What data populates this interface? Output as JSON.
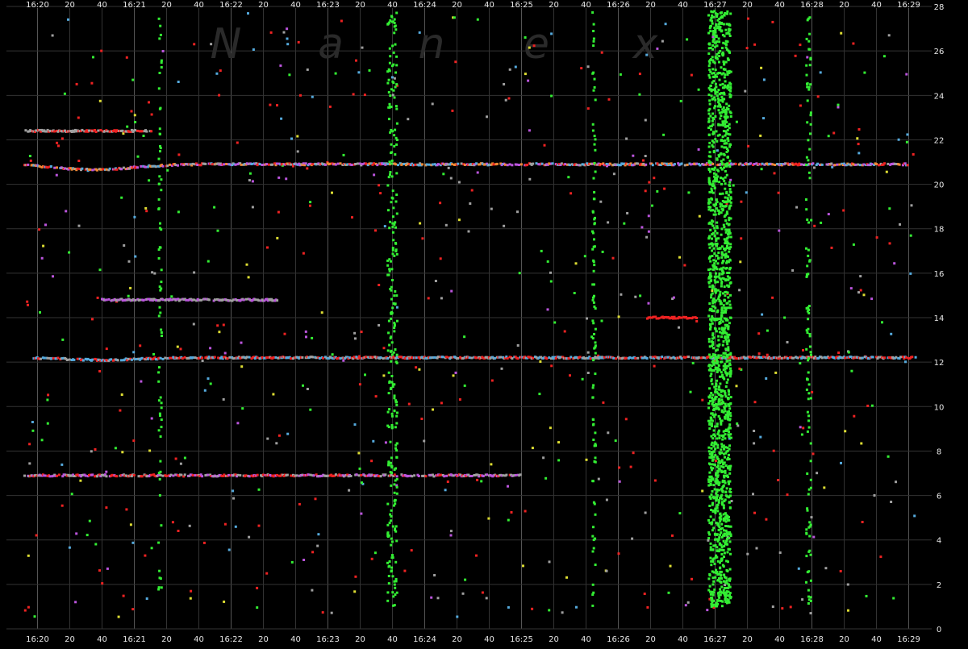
{
  "chart_data": {
    "type": "scatter",
    "watermark": [
      "N",
      "a",
      "n",
      "e",
      "x"
    ],
    "x_axis": {
      "range_seconds_after_1620": [
        -10,
        560
      ],
      "ticks": [
        {
          "t": 0,
          "label": "16:20",
          "major": true
        },
        {
          "t": 20,
          "label": "20",
          "major": false
        },
        {
          "t": 40,
          "label": "40",
          "major": false
        },
        {
          "t": 60,
          "label": "16:21",
          "major": true
        },
        {
          "t": 80,
          "label": "20",
          "major": false
        },
        {
          "t": 100,
          "label": "40",
          "major": false
        },
        {
          "t": 120,
          "label": "16:22",
          "major": true
        },
        {
          "t": 140,
          "label": "20",
          "major": false
        },
        {
          "t": 160,
          "label": "40",
          "major": false
        },
        {
          "t": 180,
          "label": "16:23",
          "major": true
        },
        {
          "t": 200,
          "label": "20",
          "major": false
        },
        {
          "t": 220,
          "label": "40",
          "major": false
        },
        {
          "t": 240,
          "label": "16:24",
          "major": true
        },
        {
          "t": 260,
          "label": "20",
          "major": false
        },
        {
          "t": 280,
          "label": "40",
          "major": false
        },
        {
          "t": 300,
          "label": "16:25",
          "major": true
        },
        {
          "t": 320,
          "label": "20",
          "major": false
        },
        {
          "t": 340,
          "label": "40",
          "major": false
        },
        {
          "t": 360,
          "label": "16:26",
          "major": true
        },
        {
          "t": 380,
          "label": "20",
          "major": false
        },
        {
          "t": 400,
          "label": "40",
          "major": false
        },
        {
          "t": 420,
          "label": "16:27",
          "major": true
        },
        {
          "t": 440,
          "label": "20",
          "major": false
        },
        {
          "t": 460,
          "label": "40",
          "major": false
        },
        {
          "t": 480,
          "label": "16:28",
          "major": true
        },
        {
          "t": 500,
          "label": "20",
          "major": false
        },
        {
          "t": 520,
          "label": "40",
          "major": false
        },
        {
          "t": 540,
          "label": "16:29",
          "major": true
        }
      ]
    },
    "y_axis": {
      "range": [
        0,
        28
      ],
      "ticks": [
        0,
        2,
        4,
        6,
        8,
        10,
        12,
        14,
        16,
        18,
        20,
        22,
        24,
        26,
        28
      ]
    },
    "grid": true,
    "colors": {
      "background": "#000000",
      "grid": "#3a3a3a",
      "green": "#33ee33",
      "red": "#ee2222",
      "gray": "#a0a0a0",
      "blue": "#55aadd",
      "purple": "#bb55dd",
      "yellow": "#dddd33",
      "orange": "#ee8833"
    },
    "trade_lines": [
      {
        "y0": 20.9,
        "y1": 20.9,
        "t0": -8,
        "t1": 540,
        "dip": 0.25,
        "colors": [
          "red",
          "gray",
          "blue",
          "orange",
          "purple"
        ]
      },
      {
        "y0": 12.2,
        "y1": 12.2,
        "t0": -3,
        "t1": 545,
        "dip": 0.1,
        "colors": [
          "red",
          "gray",
          "blue"
        ]
      },
      {
        "y0": 22.4,
        "y1": 22.4,
        "t0": -8,
        "t1": 72,
        "dip": 0,
        "colors": [
          "gray",
          "red"
        ]
      },
      {
        "y0": 6.9,
        "y1": 6.9,
        "t0": -8,
        "t1": 300,
        "dip": 0,
        "colors": [
          "red",
          "gray",
          "purple"
        ]
      },
      {
        "y0": 14.0,
        "y1": 14.0,
        "t0": 378,
        "t1": 410,
        "dip": 0,
        "colors": [
          "red"
        ]
      },
      {
        "y0": 14.8,
        "y1": 14.8,
        "t0": 40,
        "t1": 150,
        "dip": 0,
        "colors": [
          "gray",
          "purple"
        ]
      }
    ],
    "green_bursts": [
      {
        "t": 220,
        "width": 6,
        "count": 260
      },
      {
        "t": 423,
        "width": 14,
        "count": 1600
      },
      {
        "t": 76,
        "width": 2,
        "count": 70
      },
      {
        "t": 345,
        "width": 2,
        "count": 90
      },
      {
        "t": 478,
        "width": 3,
        "count": 110
      }
    ],
    "scatter_density": 650
  }
}
